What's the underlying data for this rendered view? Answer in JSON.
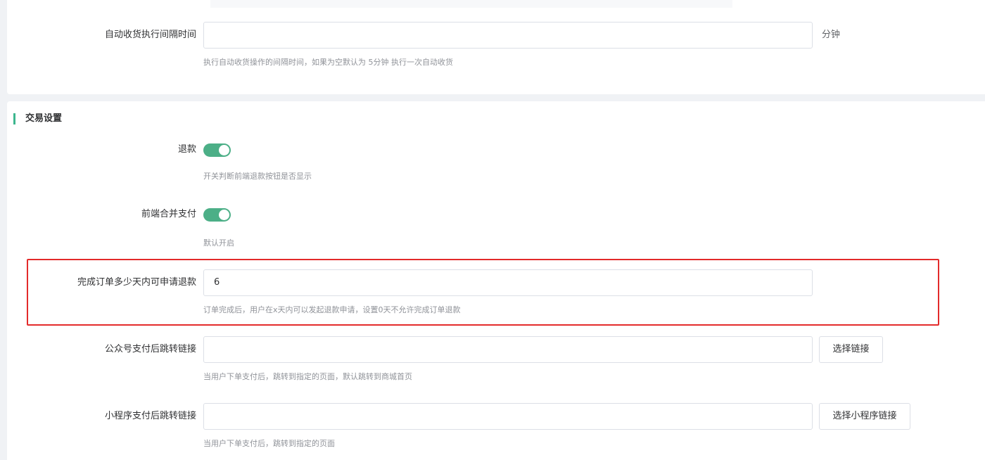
{
  "top_section": {
    "auto_receive_interval": {
      "label": "自动收货执行间隔时间",
      "value": "",
      "suffix": "分钟",
      "help": "执行自动收货操作的间隔时间，如果为空默认为 5分钟 执行一次自动收货"
    }
  },
  "trade_settings": {
    "title": "交易设置",
    "refund": {
      "label": "退款",
      "enabled": true,
      "help": "开关判断前端退款按钮是否显示"
    },
    "merge_pay": {
      "label": "前端合并支付",
      "enabled": true,
      "help": "默认开启"
    },
    "refund_days": {
      "label": "完成订单多少天内可申请退款",
      "value": "6",
      "help": "订单完成后，用户在x天内可以发起退款申请，设置0天不允许完成订单退款"
    },
    "mp_redirect": {
      "label": "公众号支付后跳转链接",
      "value": "",
      "button": "选择链接",
      "help": "当用户下单支付后，跳转到指定的页面，默认跳转到商城首页"
    },
    "miniapp_redirect": {
      "label": "小程序支付后跳转链接",
      "value": "",
      "button": "选择小程序链接",
      "help": "当用户下单支付后，跳转到指定的页面"
    }
  },
  "colors": {
    "accent": "#3cb68e",
    "switch_on": "#4caf87",
    "highlight": "#e32b2b"
  }
}
